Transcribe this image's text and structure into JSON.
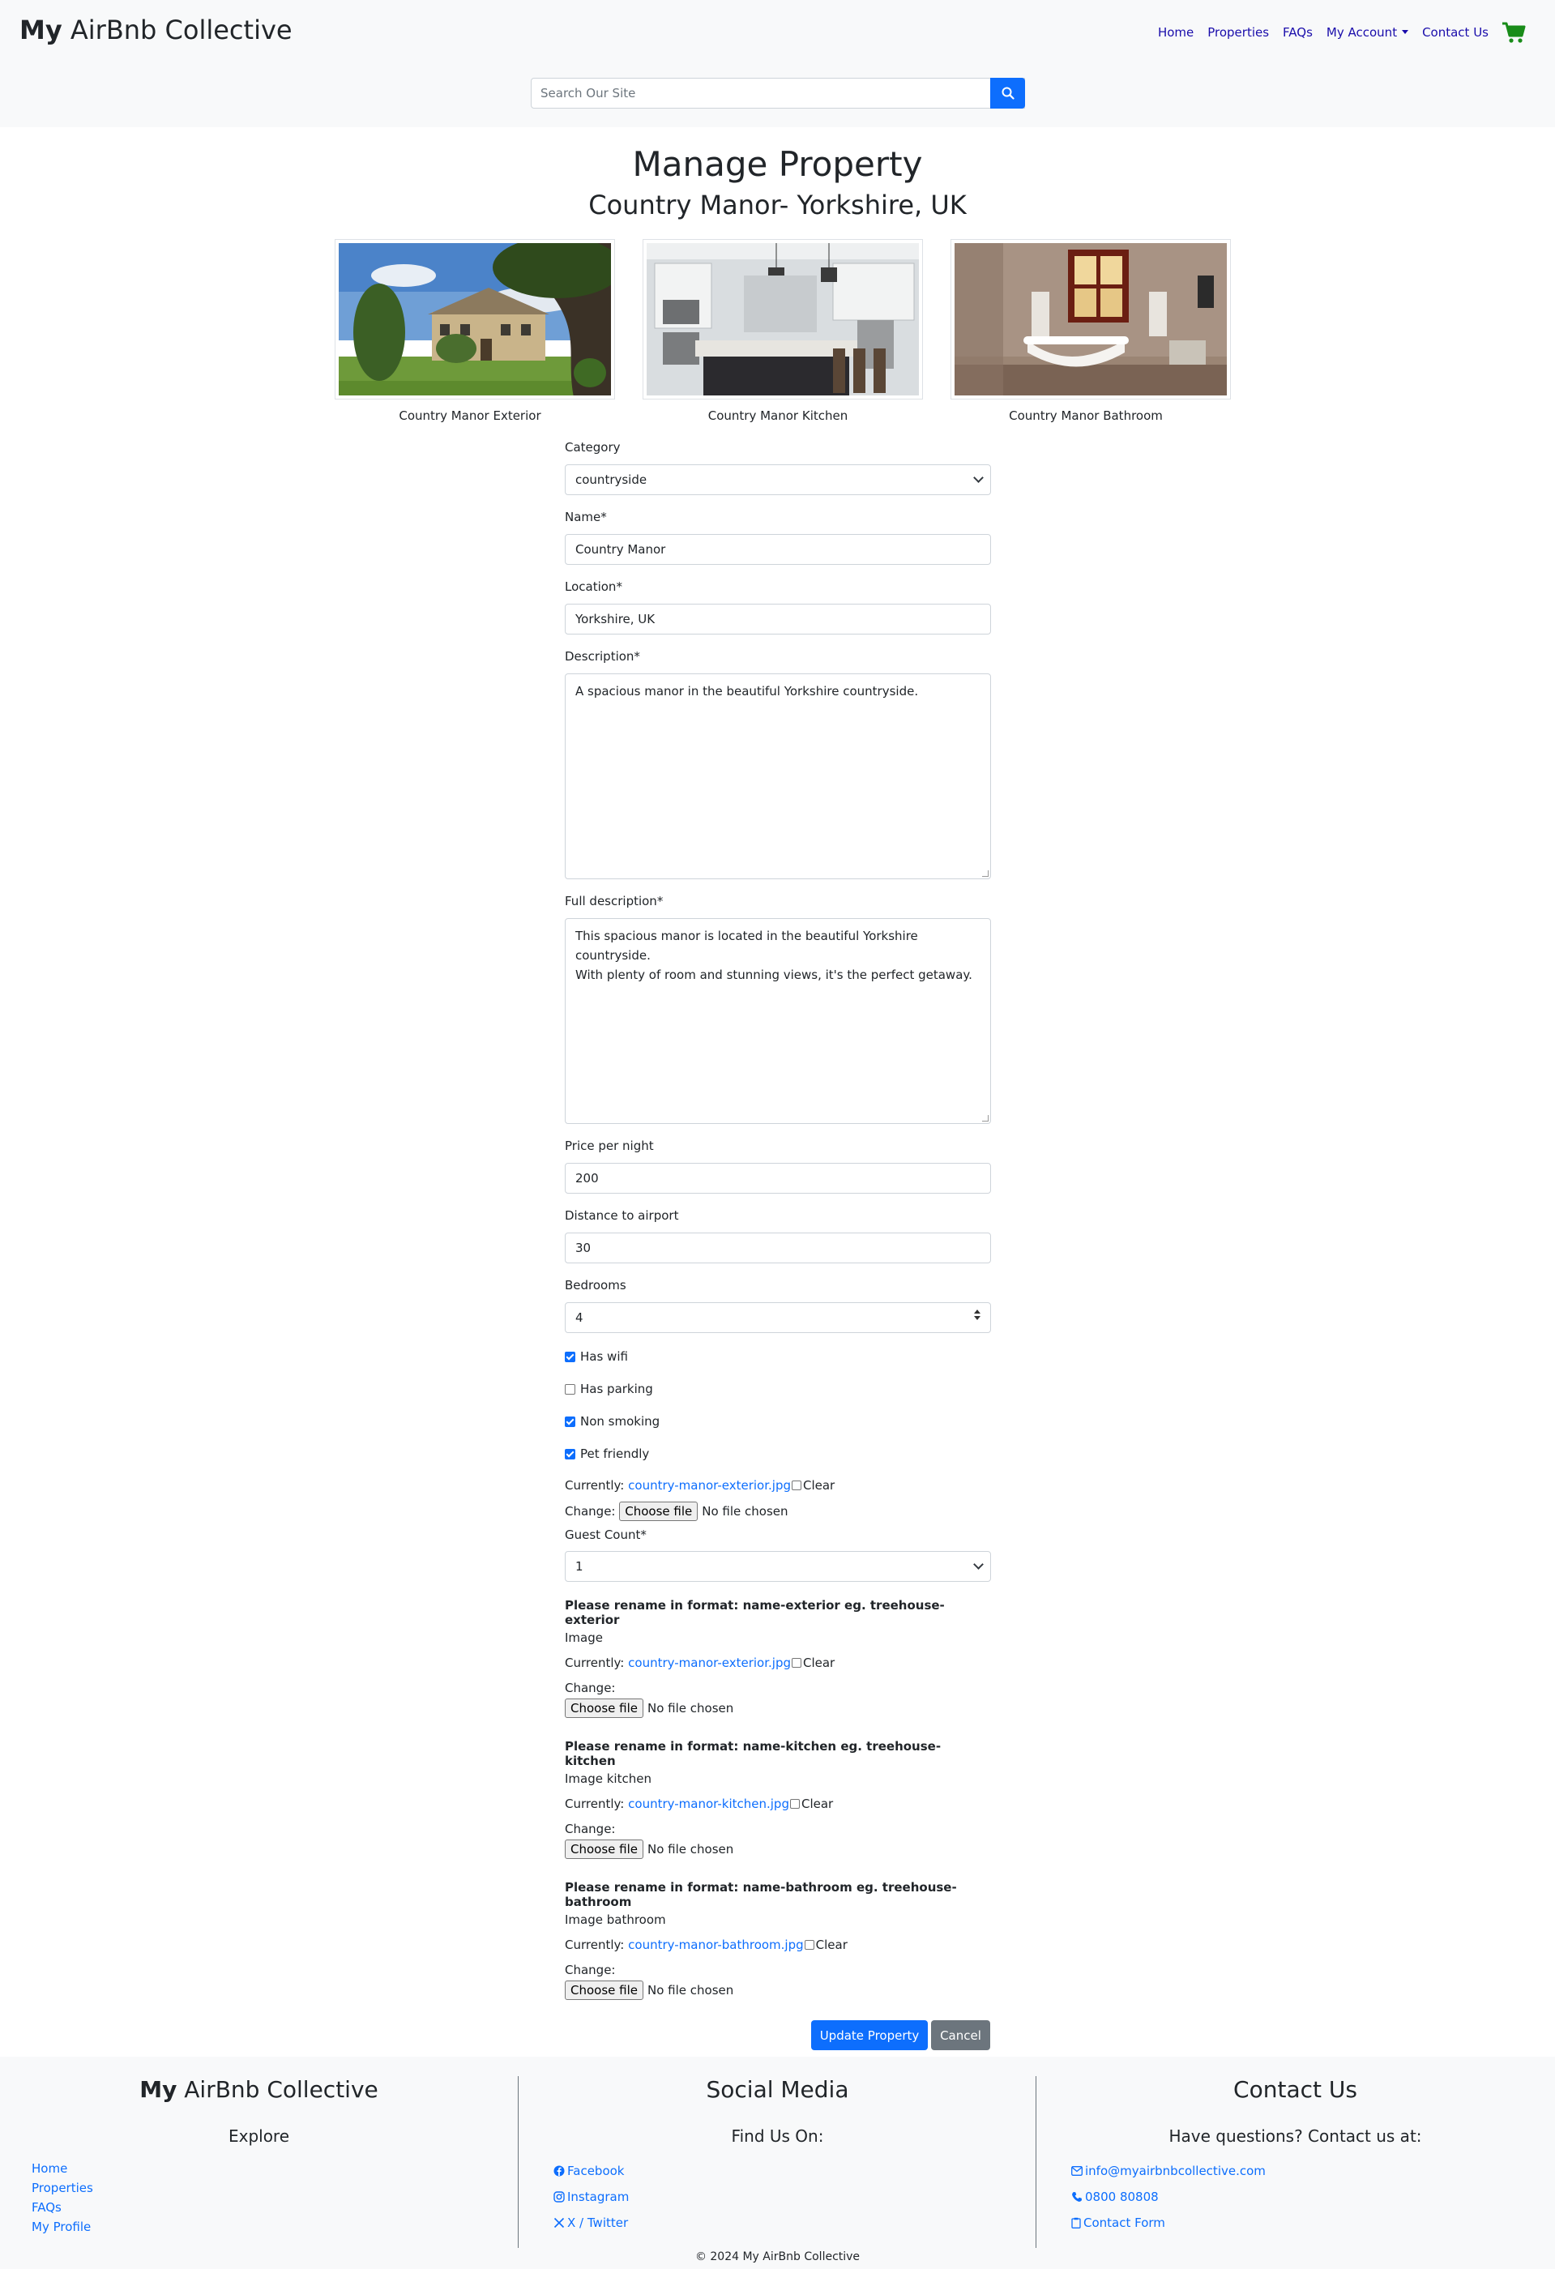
{
  "header": {
    "brand_bold": "My",
    "brand_rest": " AirBnb Collective",
    "nav": [
      "Home",
      "Properties",
      "FAQs",
      "My Account",
      "Contact Us"
    ],
    "search_placeholder": "Search Our Site"
  },
  "page": {
    "title": "Manage Property",
    "subtitle": "Country Manor- Yorkshire, UK"
  },
  "gallery": [
    {
      "caption": "Country Manor Exterior"
    },
    {
      "caption": "Country Manor Kitchen"
    },
    {
      "caption": "Country Manor Bathroom"
    }
  ],
  "form": {
    "category_label": "Category",
    "category_value": "countryside",
    "name_label": "Name*",
    "name_value": "Country Manor",
    "location_label": "Location*",
    "location_value": "Yorkshire, UK",
    "description_label": "Description*",
    "description_value": "A spacious manor in the beautiful Yorkshire countryside.",
    "full_description_label": "Full description*",
    "full_description_line1": "This spacious manor is located in the beautiful Yorkshire countryside.",
    "full_description_line2": "With plenty of room and stunning views, it's the perfect getaway.",
    "price_label": "Price per night",
    "price_value": "200",
    "distance_label": "Distance to airport",
    "distance_value": "30",
    "bedrooms_label": "Bedrooms",
    "bedrooms_value": "4",
    "checks": [
      {
        "label": "Has wifi",
        "checked": true
      },
      {
        "label": "Has parking",
        "checked": false
      },
      {
        "label": "Non smoking",
        "checked": true
      },
      {
        "label": "Pet friendly",
        "checked": true
      }
    ],
    "currently_label": "Currently:",
    "change_label": "Change:",
    "clear_label": "Clear",
    "choose_file": "Choose file",
    "no_file": "No file chosen",
    "file1_current": "country-manor-exterior.jpg",
    "guest_label": "Guest Count*",
    "guest_value": "1",
    "note_exterior": "Please rename in format: name-exterior eg. treehouse-exterior",
    "image_label": "Image",
    "image_current": "country-manor-exterior.jpg",
    "note_kitchen": "Please rename in format: name-kitchen eg. treehouse-kitchen",
    "image_kitchen_label": "Image kitchen",
    "image_kitchen_current": "country-manor-kitchen.jpg",
    "note_bathroom": "Please rename in format: name-bathroom eg. treehouse-bathroom",
    "image_bathroom_label": "Image bathroom",
    "image_bathroom_current": "country-manor-bathroom.jpg",
    "update_button": "Update Property",
    "cancel_button": "Cancel"
  },
  "footer": {
    "brand_bold": "My",
    "brand_rest": " AirBnb Collective",
    "explore": "Explore",
    "explore_links": [
      "Home",
      "Properties",
      "FAQs",
      "My Profile"
    ],
    "social_title": "Social Media",
    "social_sub": "Find Us On:",
    "social_links": [
      "Facebook",
      "Instagram",
      "X / Twitter"
    ],
    "contact_title": "Contact Us",
    "contact_sub": "Have questions? Contact us at:",
    "email": "info@myairbnbcollective.com",
    "phone": "0800 80808",
    "contact_form": "Contact Form",
    "copyright": "© 2024 My AirBnb Collective"
  },
  "colors": {
    "primary": "#0d6efd",
    "secondary": "#6c757d",
    "cart": "#198c19",
    "nav_link": "#1a0dab",
    "header_bg": "#f8f9fa"
  }
}
